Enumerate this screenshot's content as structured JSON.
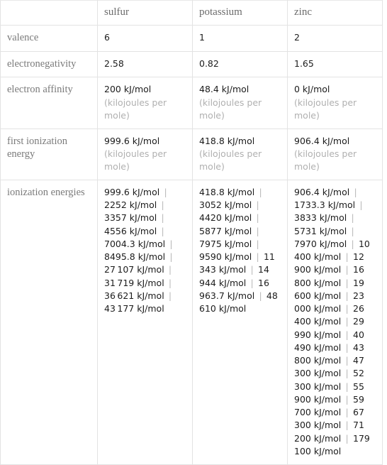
{
  "table": {
    "corner_label": "",
    "columns": [
      "sulfur",
      "potassium",
      "zinc"
    ],
    "rows": [
      {
        "label": "valence",
        "cells": [
          {
            "value": "6",
            "unit": ""
          },
          {
            "value": "1",
            "unit": ""
          },
          {
            "value": "2",
            "unit": ""
          }
        ]
      },
      {
        "label": "electronegativity",
        "cells": [
          {
            "value": "2.58",
            "unit": ""
          },
          {
            "value": "0.82",
            "unit": ""
          },
          {
            "value": "1.65",
            "unit": ""
          }
        ]
      },
      {
        "label": "electron affinity",
        "cells": [
          {
            "value": "200 kJ/mol",
            "unit": "(kilojoules per mole)"
          },
          {
            "value": "48.4 kJ/mol",
            "unit": "(kilojoules per mole)"
          },
          {
            "value": "0 kJ/mol",
            "unit": "(kilojoules per mole)"
          }
        ]
      },
      {
        "label": "first ionization energy",
        "cells": [
          {
            "value": "999.6 kJ/mol",
            "unit": "(kilojoules per mole)"
          },
          {
            "value": "418.8 kJ/mol",
            "unit": "(kilojoules per mole)"
          },
          {
            "value": "906.4 kJ/mol",
            "unit": "(kilojoules per mole)"
          }
        ]
      },
      {
        "label": "ionization energies",
        "cells": [
          {
            "value": "999.6 kJ/mol | 2252 kJ/mol | 3357 kJ/mol | 4556 kJ/mol | 7004.3 kJ/mol | 8495.8 kJ/mol | 27 107 kJ/mol | 31 719 kJ/mol | 36 621 kJ/mol | 43 177 kJ/mol",
            "unit": "",
            "list": [
              "999.6 kJ/mol",
              "2252 kJ/mol",
              "3357 kJ/mol",
              "4556 kJ/mol",
              "7004.3 kJ/mol",
              "8495.8 kJ/mol",
              "27 107 kJ/mol",
              "31 719 kJ/mol",
              "36 621 kJ/mol",
              "43 177 kJ/mol"
            ]
          },
          {
            "value": "418.8 kJ/mol | 3052 kJ/mol | 4420 kJ/mol | 5877 kJ/mol | 7975 kJ/mol | 9590 kJ/mol | 11 343 kJ/mol | 14 944 kJ/mol | 16 963.7 kJ/mol | 48 610 kJ/mol",
            "unit": "",
            "list": [
              "418.8 kJ/mol",
              "3052 kJ/mol",
              "4420 kJ/mol",
              "5877 kJ/mol",
              "7975 kJ/mol",
              "9590 kJ/mol",
              "11 343 kJ/mol",
              "14 944 kJ/mol",
              "16 963.7 kJ/mol",
              "48 610 kJ/mol"
            ]
          },
          {
            "value": "906.4 kJ/mol | 1733.3 kJ/mol | 3833 kJ/mol | 5731 kJ/mol | 7970 kJ/mol | 10 400 kJ/mol | 12 900 kJ/mol | 16 800 kJ/mol | 19 600 kJ/mol | 23 000 kJ/mol | 26 400 kJ/mol | 29 990 kJ/mol | 40 490 kJ/mol | 43 800 kJ/mol | 47 300 kJ/mol | 52 300 kJ/mol | 55 900 kJ/mol | 59 700 kJ/mol | 67 300 kJ/mol | 71 200 kJ/mol | 179 100 kJ/mol",
            "unit": "",
            "list": [
              "906.4 kJ/mol",
              "1733.3 kJ/mol",
              "3833 kJ/mol",
              "5731 kJ/mol",
              "7970 kJ/mol",
              "10 400 kJ/mol",
              "12 900 kJ/mol",
              "16 800 kJ/mol",
              "19 600 kJ/mol",
              "23 000 kJ/mol",
              "26 400 kJ/mol",
              "29 990 kJ/mol",
              "40 490 kJ/mol",
              "43 800 kJ/mol",
              "47 300 kJ/mol",
              "52 300 kJ/mol",
              "55 900 kJ/mol",
              "59 700 kJ/mol",
              "67 300 kJ/mol",
              "71 200 kJ/mol",
              "179 100 kJ/mol"
            ]
          }
        ]
      }
    ]
  },
  "colors": {
    "border": "#e3e3e3",
    "header_text": "#6b6b6b",
    "label_text": "#7a7a7a",
    "value_text": "#1c1c1c",
    "unit_text": "#b0b0b0",
    "separator": "#b8b8b8"
  }
}
